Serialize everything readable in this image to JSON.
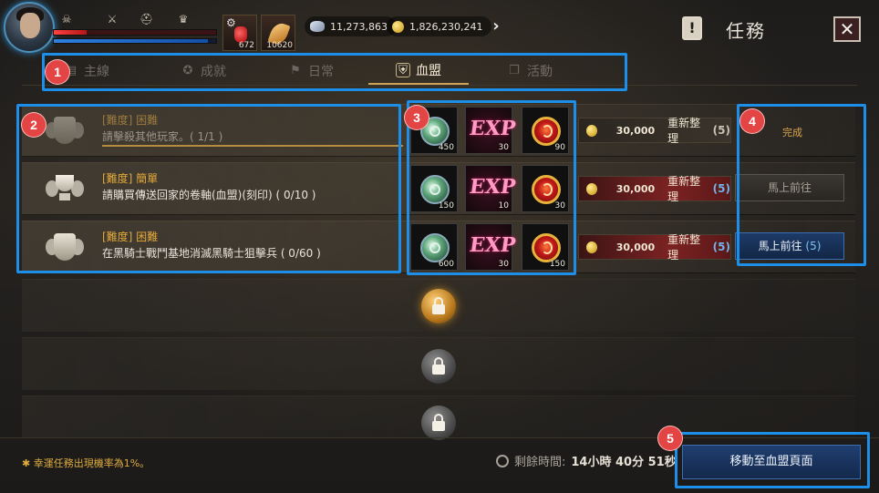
{
  "player": {
    "potion_count": "672",
    "feather_count": "10620",
    "hp_fraction": 0.2,
    "mp_fraction": 0.95
  },
  "currency": {
    "gems": "11,273,863",
    "gold": "1,826,230,241"
  },
  "window": {
    "title": "任務",
    "close_symbol": "✕",
    "title_icon_glyph": "!"
  },
  "tabs": [
    {
      "label": "主線",
      "icon": "book-icon",
      "active": false
    },
    {
      "label": "成就",
      "icon": "medal-icon",
      "active": false
    },
    {
      "label": "日常",
      "icon": "flag-icon",
      "active": false
    },
    {
      "label": "血盟",
      "icon": "shield-icon",
      "active": true
    },
    {
      "label": "活動",
      "icon": "gift-icon",
      "active": false
    }
  ],
  "quests": [
    {
      "difficulty": "[難度] 困難",
      "description": "請擊殺其他玩家。( 1/1 )",
      "progress": 1.0,
      "rewards": [
        {
          "type": "silver-orb",
          "qty": "450"
        },
        {
          "type": "exp",
          "qty": "30",
          "label": "EXP"
        },
        {
          "type": "fire-orb",
          "qty": "90"
        }
      ],
      "refresh": {
        "cost": "30,000",
        "label": "重新整理",
        "count": "(5)"
      },
      "status": "完成"
    },
    {
      "difficulty": "[難度] 簡單",
      "description": "請購買傳送回家的卷軸(血盟)(刻印) ( 0/10 )",
      "progress": 0,
      "rewards": [
        {
          "type": "silver-orb",
          "qty": "150"
        },
        {
          "type": "exp",
          "qty": "10",
          "label": "EXP"
        },
        {
          "type": "fire-orb",
          "qty": "30"
        }
      ],
      "refresh": {
        "cost": "30,000",
        "label": "重新整理",
        "count": "(5)"
      },
      "action": {
        "label": "馬上前往",
        "count": ""
      }
    },
    {
      "difficulty": "[難度] 困難",
      "description": "在黑騎士戰鬥基地消滅黑騎士狙擊兵 ( 0/60 )",
      "progress": 0,
      "rewards": [
        {
          "type": "silver-orb",
          "qty": "600"
        },
        {
          "type": "exp",
          "qty": "30",
          "label": "EXP"
        },
        {
          "type": "fire-orb",
          "qty": "150"
        }
      ],
      "refresh": {
        "cost": "30,000",
        "label": "重新整理",
        "count": "(5)"
      },
      "action": {
        "label": "馬上前往",
        "count": "(5)"
      }
    }
  ],
  "annotations": [
    "1",
    "2",
    "3",
    "4",
    "5"
  ],
  "footer": {
    "lucky_note": "✱ 幸運任務出現機率為1%。",
    "timer_label": "剩餘時間:",
    "timer_value": "14小時 40分 51秒",
    "guild_button": "移動至血盟頁面"
  },
  "colors": {
    "accent_blue": "#1e8fe8",
    "badge_red": "#e34545",
    "difficulty_gold": "#e2a93a"
  }
}
